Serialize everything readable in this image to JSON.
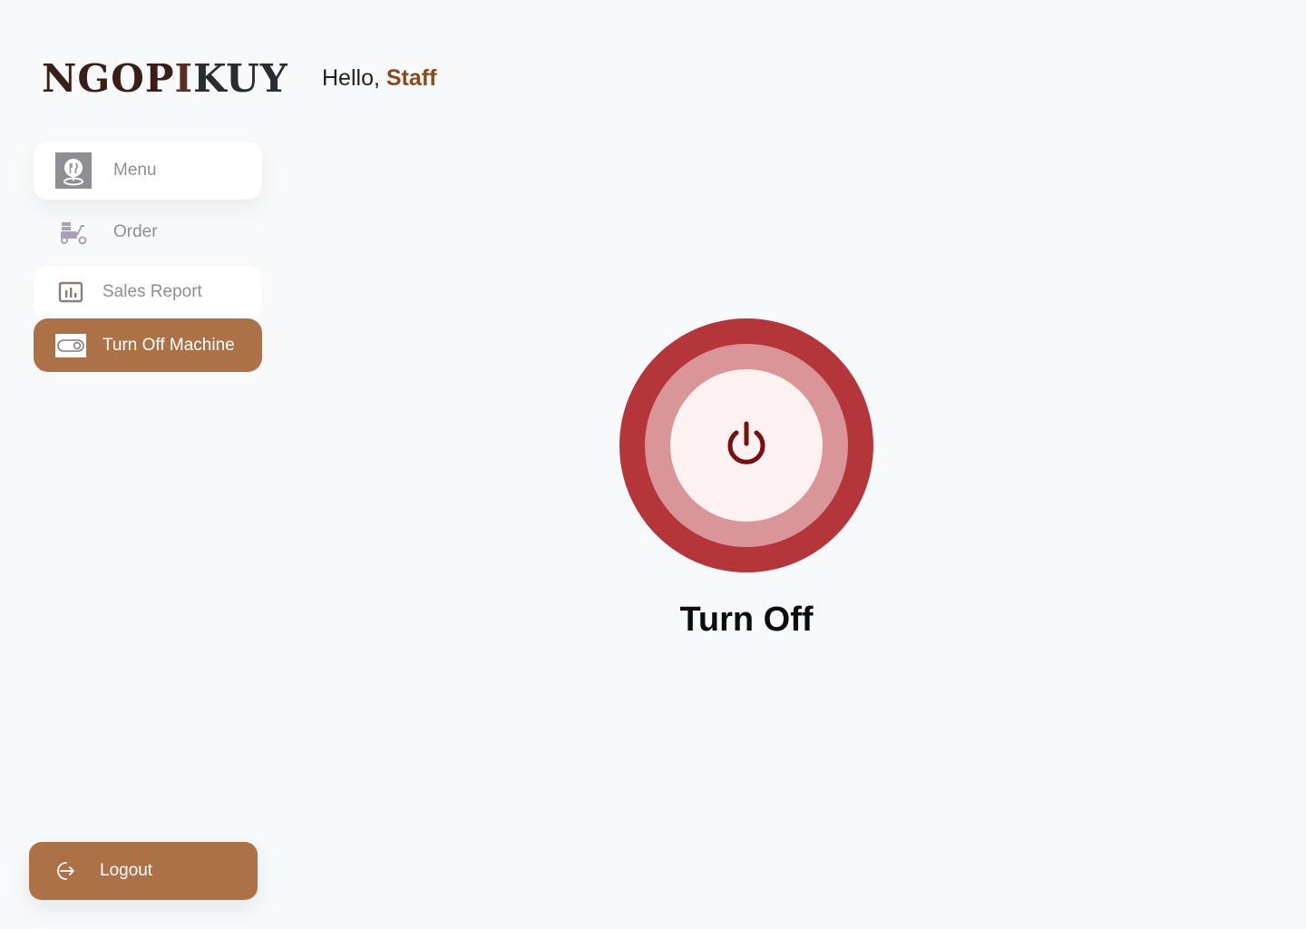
{
  "brand": {
    "part_a": "NGOP",
    "part_b": "I",
    "part_c": "KUY"
  },
  "header": {
    "greeting": "Hello,",
    "user_name": "Staff"
  },
  "sidebar": {
    "items": [
      {
        "label": "Menu",
        "icon": "menu-food-icon",
        "active": false
      },
      {
        "label": "Order",
        "icon": "delivery-scooter-icon",
        "active": false
      },
      {
        "label": "Sales Report",
        "icon": "bar-chart-icon",
        "active": false
      },
      {
        "label": "Turn Off Machine",
        "icon": "toggle-icon",
        "active": true
      }
    ],
    "logout": {
      "label": "Logout",
      "icon": "logout-icon"
    }
  },
  "main": {
    "power_button": {
      "icon": "power-icon",
      "caption": "Turn Off"
    }
  },
  "colors": {
    "accent": "#ad7148",
    "name_highlight": "#8a4a1e",
    "power_outer": "#b5363a",
    "power_mid": "#d99597",
    "power_inner": "#fdf2f1",
    "power_glyph": "#7a0d0d",
    "background": "#f8f9fb"
  }
}
